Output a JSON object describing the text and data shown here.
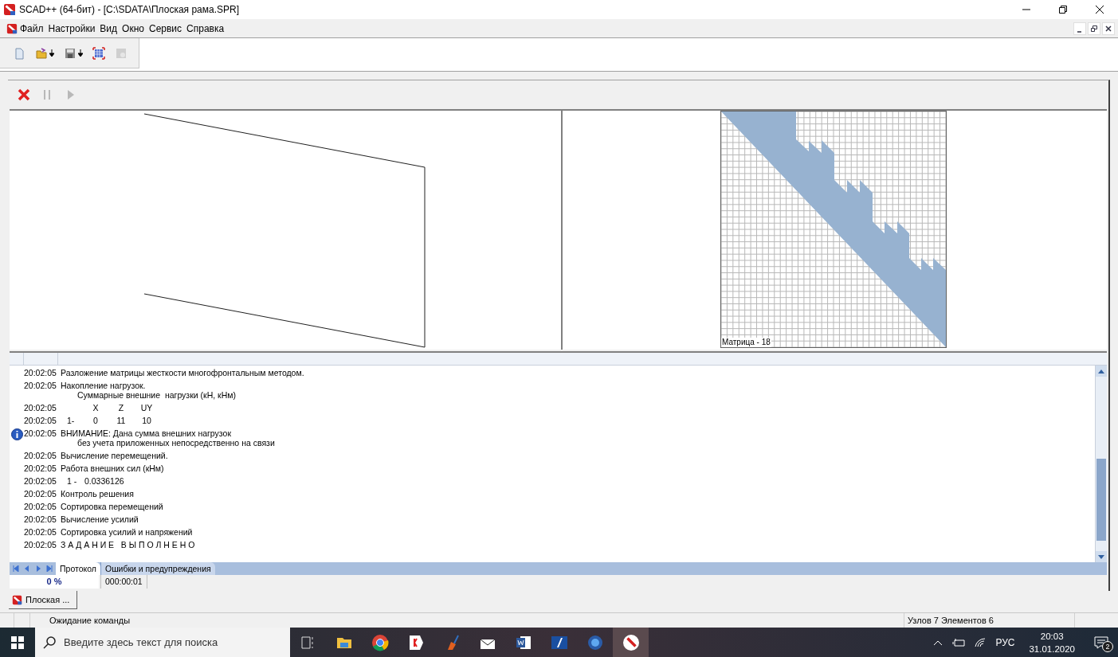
{
  "window": {
    "title": "SCAD++ (64-бит) - [C:\\SDATA\\Плоская рама.SPR]"
  },
  "menu": [
    "Файл",
    "Настройки",
    "Вид",
    "Окно",
    "Сервис",
    "Справка"
  ],
  "toolbar": [
    {
      "kind": "new",
      "disabled": false,
      "dropdown": false
    },
    {
      "kind": "open",
      "disabled": false,
      "dropdown": true
    },
    {
      "kind": "save",
      "disabled": false,
      "dropdown": true
    },
    {
      "kind": "matrix",
      "disabled": false,
      "dropdown": false
    },
    {
      "kind": "settings",
      "disabled": true,
      "dropdown": false
    }
  ],
  "run_controls": [
    {
      "kind": "stop",
      "disabled": false
    },
    {
      "kind": "pause",
      "disabled": true
    },
    {
      "kind": "play",
      "disabled": true
    }
  ],
  "matrix": {
    "label": "Матрица - 18"
  },
  "log": {
    "entries": [
      {
        "time": "20:02:05",
        "kind": "text",
        "info": false,
        "lines": [
          "Разложение матрицы жесткости многофронтальным методом."
        ]
      },
      {
        "time": "20:02:05",
        "kind": "text",
        "info": false,
        "lines": [
          "Накопление нагрузок.",
          "Суммарные внешние  нагрузки (кН, кНм)"
        ]
      },
      {
        "time": "20:02:05",
        "kind": "header",
        "info": false,
        "cells": [
          "X",
          "Z",
          "UY"
        ]
      },
      {
        "time": "20:02:05",
        "kind": "table",
        "info": false,
        "cells": [
          "1-",
          "0",
          "11",
          "10"
        ]
      },
      {
        "time": "20:02:05",
        "kind": "text",
        "info": true,
        "lines": [
          "ВНИМАНИЕ: Дана сумма внешних нагрузок",
          "без учета приложенных непосредственно на связи"
        ]
      },
      {
        "time": "20:02:05",
        "kind": "text",
        "info": false,
        "lines": [
          "Вычисление перемещений."
        ]
      },
      {
        "time": "20:02:05",
        "kind": "text",
        "info": false,
        "lines": [
          "Работа внешних сил (кНм)"
        ]
      },
      {
        "time": "20:02:05",
        "kind": "table",
        "info": false,
        "cells": [
          "1 -",
          "0.0336126"
        ]
      },
      {
        "time": "20:02:05",
        "kind": "text",
        "info": false,
        "lines": [
          "Контроль решения"
        ]
      },
      {
        "time": "20:02:05",
        "kind": "text",
        "info": false,
        "lines": [
          "Сортировка перемещений"
        ]
      },
      {
        "time": "20:02:05",
        "kind": "text",
        "info": false,
        "lines": [
          "Вычисление усилий"
        ]
      },
      {
        "time": "20:02:05",
        "kind": "text",
        "info": false,
        "lines": [
          "Сортировка усилий и напряжений"
        ]
      },
      {
        "time": "20:02:05",
        "kind": "text",
        "info": false,
        "lines": [
          "З А Д А Н И Е   В Ы П О Л Н Е Н О"
        ]
      }
    ],
    "tabs": [
      {
        "label": "Протокол",
        "selected": true
      },
      {
        "label": "Ошибки и предупреждения",
        "selected": false
      }
    ],
    "progress": "0 %",
    "elapsed": "000:00:01"
  },
  "document_tab": {
    "label": "Плоская ..."
  },
  "status_bar": {
    "message": "Ожидание команды",
    "counts": "Узлов 7 Элементов 6"
  },
  "taskbar": {
    "search": {
      "placeholder": "Введите здесь текст для поиска"
    },
    "language": "РУС",
    "time": "20:03",
    "date": "31.01.2020",
    "notifications": "2"
  }
}
